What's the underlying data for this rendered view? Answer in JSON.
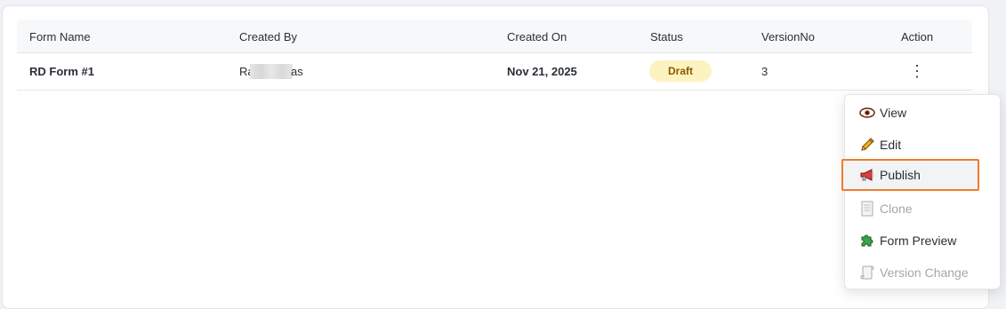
{
  "table": {
    "headers": {
      "form_name": "Form Name",
      "created_by": "Created By",
      "created_on": "Created On",
      "status": "Status",
      "version_no": "VersionNo",
      "action": "Action"
    },
    "rows": [
      {
        "form_name": "RD Form #1",
        "created_by_start": "Ra",
        "created_by_end": "as",
        "created_on": "Nov 21, 2025",
        "status": "Draft",
        "version_no": "3",
        "action_icon": "⋮"
      }
    ]
  },
  "menu": {
    "items": [
      {
        "label": "View",
        "icon": "eye-icon",
        "enabled": true
      },
      {
        "label": "Edit",
        "icon": "pencil-icon",
        "enabled": true
      },
      {
        "label": "Publish",
        "icon": "megaphone-icon",
        "enabled": true,
        "highlighted": true
      },
      {
        "label": "Clone",
        "icon": "document-icon",
        "enabled": false
      },
      {
        "label": "Form Preview",
        "icon": "puzzle-icon",
        "enabled": true
      },
      {
        "label": "Version Change",
        "icon": "scroll-icon",
        "enabled": false
      }
    ]
  },
  "colors": {
    "badge_bg": "#fdf3c0",
    "badge_text": "#8a5a00",
    "highlight_border": "#f07c2a"
  }
}
